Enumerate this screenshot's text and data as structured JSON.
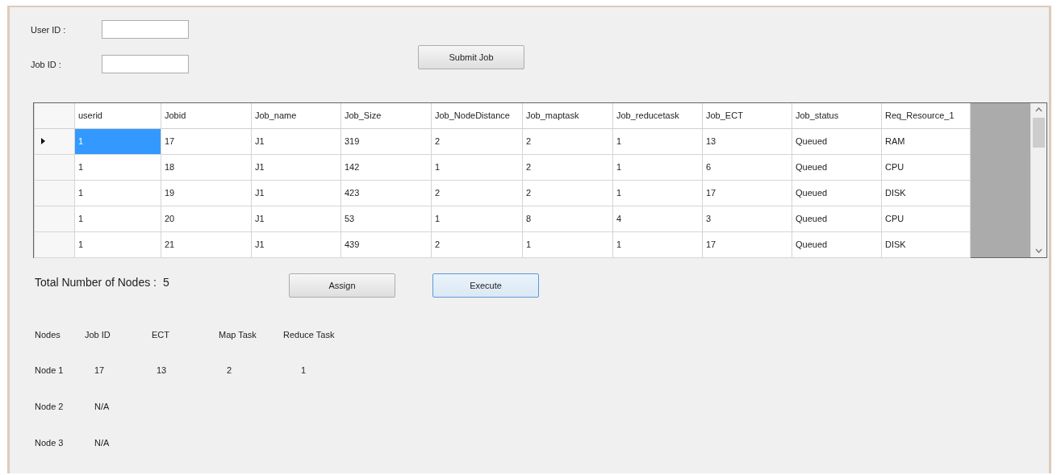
{
  "form": {
    "fields": [
      {
        "label": "User ID :"
      },
      {
        "label": "Job ID :"
      }
    ],
    "submit_button": {
      "label": "Submit Job"
    }
  },
  "table": {
    "columns": [
      "userid",
      "Jobid",
      "Job_name",
      "Job_Size",
      "Job_NodeDistance",
      "Job_maptask",
      "Job_reducetask",
      "Job_ECT",
      "Job_status",
      "Req_Resource_1"
    ],
    "rows": [
      {
        "selected": true,
        "cells": [
          "1",
          "17",
          "J1",
          "319",
          "2",
          "2",
          "1",
          "13",
          "Queued",
          "RAM"
        ]
      },
      {
        "selected": false,
        "cells": [
          "1",
          "18",
          "J1",
          "142",
          "1",
          "2",
          "1",
          "6",
          "Queued",
          "CPU"
        ]
      },
      {
        "selected": false,
        "cells": [
          "1",
          "19",
          "J1",
          "423",
          "2",
          "2",
          "1",
          "17",
          "Queued",
          "DISK"
        ]
      },
      {
        "selected": false,
        "cells": [
          "1",
          "20",
          "J1",
          "53",
          "1",
          "8",
          "4",
          "3",
          "Queued",
          "CPU"
        ]
      },
      {
        "selected": false,
        "cells": [
          "1",
          "21",
          "J1",
          "439",
          "2",
          "1",
          "1",
          "17",
          "Queued",
          "DISK"
        ]
      }
    ]
  },
  "total_nodes": {
    "label": "Total Number of Nodes :",
    "value": "5"
  },
  "buttons": [
    {
      "label": "Assign",
      "focused": false
    },
    {
      "label": "Execute",
      "focused": true
    }
  ],
  "nodes": {
    "columns": [
      "Nodes",
      "Job ID",
      "ECT",
      "Map Task",
      "Reduce Task"
    ],
    "rows": [
      [
        "Node 1",
        "17",
        "13",
        "2",
        "1"
      ],
      [
        "Node 2",
        "N/A"
      ],
      [
        "Node 3",
        "N/A"
      ]
    ]
  }
}
